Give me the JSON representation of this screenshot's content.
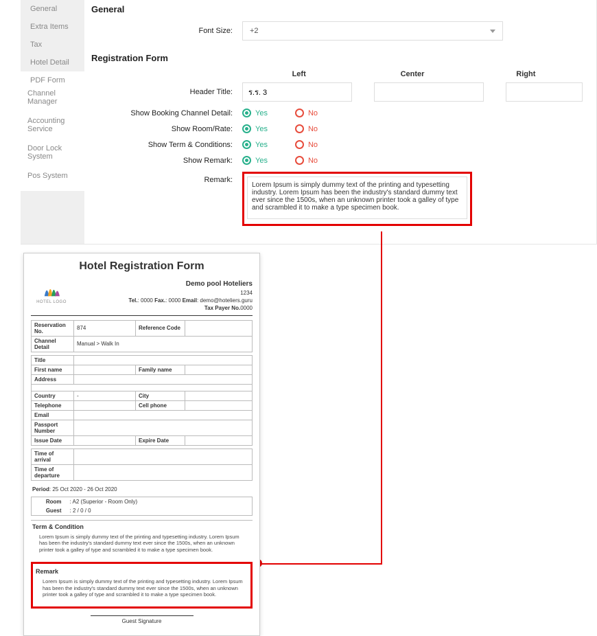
{
  "sidebar": {
    "items": [
      {
        "label": "General"
      },
      {
        "label": "Extra Items"
      },
      {
        "label": "Tax"
      },
      {
        "label": "Hotel Detail"
      },
      {
        "label": "PDF Form"
      },
      {
        "label": "Channel Manager"
      },
      {
        "label": "Accounting Service"
      },
      {
        "label": "Door Lock System"
      },
      {
        "label": "Pos System"
      }
    ]
  },
  "general": {
    "heading": "General",
    "fontSizeLabel": "Font Size:",
    "fontSizeValue": "+2"
  },
  "regForm": {
    "heading": "Registration Form",
    "colLeft": "Left",
    "colCenter": "Center",
    "colRight": "Right",
    "headerTitleLabel": "Header Title:",
    "headerTitleLeft": "ร.ร. 3",
    "showBookingLabel": "Show Booking Channel Detail:",
    "showRoomLabel": "Show Room/Rate:",
    "showTermLabel": "Show Term & Conditions:",
    "showRemarkLabel": "Show Remark:",
    "remarkLabel": "Remark:",
    "yes": "Yes",
    "no": "No",
    "remarkText": "Lorem Ipsum is simply dummy text of the printing and typesetting industry. Lorem Ipsum has been the industry's standard dummy text ever since the 1500s, when an unknown printer took a galley of type and scrambled it to make a type specimen book."
  },
  "preview": {
    "title": "Hotel Registration Form",
    "logoCaption": "HOTEL LOGO",
    "hotelName": "Demo pool Hoteliers",
    "hotelAddr": "1234",
    "telLabel": "Tel.",
    "telVal": ": 0000",
    "faxLabel": "Fax.",
    "faxVal": ": 0000",
    "emailLabel": "Email",
    "emailVal": ": demo@hoteliers.guru",
    "taxLabel": "Tax Payer No.",
    "taxVal": "0000",
    "resNoLabel": "Reservation No.",
    "resNoVal": "874",
    "refCodeLabel": "Reference Code",
    "chanLabel": "Channel Detail",
    "chanVal": "Manual > Walk In",
    "titleLabel": "Title",
    "fnameLabel": "First name",
    "lnameLabel": "Family name",
    "addrLabel": "Address",
    "countryLabel": "Country",
    "countryVal": "-",
    "cityLabel": "City",
    "telLabel2": "Telephone",
    "cellLabel": "Cell phone",
    "emailLabel2": "Email",
    "passportLabel": "Passport Number",
    "issueLabel": "Issue Date",
    "expireLabel": "Expire Date",
    "arrivalLabel": "Time of arrival",
    "departLabel": "Time of departure",
    "periodLabel": "Period",
    "periodVal": ": 25 Oct 2020 - 26 Oct 2020",
    "roomLabel": "Room",
    "roomVal": ": A2 (Superior - Room Only)",
    "guestLabel": "Guest",
    "guestVal": ": 2 / 0 / 0",
    "termTitle": "Term & Condition",
    "termText": "Lorem Ipsum is simply dummy text of the printing and typesetting industry. Lorem Ipsum has been the industry's standard dummy text ever since the 1500s, when an unknown printer took a galley of type and scrambled it to make a type specimen book.",
    "remarkTitle": "Remark",
    "remarkText": "Lorem Ipsum is simply dummy text of the printing and typesetting industry. Lorem Ipsum has been the industry's standard dummy text ever since the 1500s, when an unknown printer took a galley of type and scrambled it to make a type specimen book.",
    "sigLabel": "Guest Signature"
  }
}
